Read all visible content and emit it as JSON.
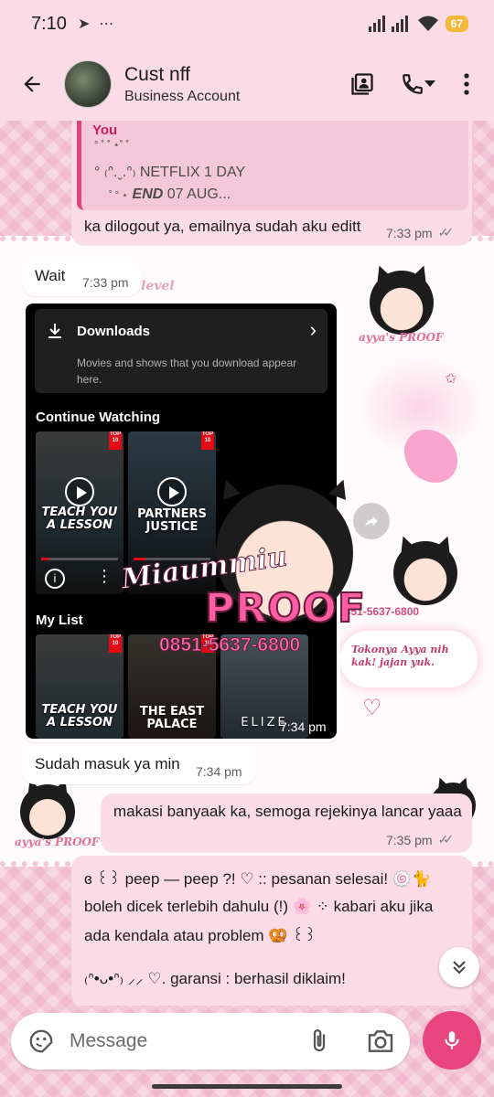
{
  "status_bar": {
    "time": "7:10",
    "battery": "67"
  },
  "header": {
    "contact_name": "Cust nff",
    "subtitle": "Business Account"
  },
  "messages": {
    "quoted": {
      "sender": "You",
      "line1": "°  ˚   ˚ ⋆˚ ˚",
      "line2": "°  ₍ᐢ.ˬ.ᐢ₎ NETFLIX 1 DAY",
      "line3_prefix": "˚ °  ⋆",
      "line3_bold": "END",
      "line3_rest": "07 AUG..."
    },
    "out1": {
      "text": "ka dilogout ya, emailnya sudah aku editt",
      "time": "7:33 pm"
    },
    "in1": {
      "text": "Wait",
      "time": "7:33 pm"
    },
    "image_msg": {
      "time": "7:34 pm",
      "downloads_title": "Downloads",
      "downloads_desc": "Movies and shows that you download appear here.",
      "continue_title": "Continue Watching",
      "mylist_title": "My List",
      "top10_label": "TOP 10",
      "posters": [
        {
          "title": "TEACH YOU A LESSON",
          "progress": 0.1
        },
        {
          "title": "PARTNERS JUSTICE",
          "progress": 0.15
        }
      ],
      "list_posters": [
        "TEACH YOU A LESSON",
        "THE EAST PALACE",
        "ELIZE"
      ]
    },
    "watermark": {
      "script_text": "Miaummiu",
      "proof_text": "PROOF",
      "phone": "0851-5637-6800"
    },
    "in2": {
      "text": "Sudah masuk ya min",
      "time": "7:34 pm"
    },
    "out2": {
      "text": "makasi banyaak ka, semoga rejekinya lancar yaaa",
      "time": "7:35 pm"
    },
    "out3": {
      "line1": "ɞ ꒰꒱ peep — peep  ?!  ♡  :: pesanan selesai!  🍥🐈",
      "line2": "boleh dicek terlebih dahulu  (!)  🌸  ⁘  kabari aku jika",
      "line3": "ada kendala atau problem 🥨  ꒰꒱",
      "line4": "₍ᐢ•ᴗ•ᐢ₎ ⸝⸝  ♡.  garansi : berhasil diklaim!"
    }
  },
  "wallpaper": {
    "sticker_proof": "ayya's PROOF",
    "sticker_phone": "0851-5637-6800",
    "sticker_note": "Tokonya Ayya nih kak! jajan yuk.",
    "sticker_proof2": "ayya's PROOF",
    "sticker_level": "level"
  },
  "input": {
    "placeholder": "Message"
  },
  "colors": {
    "accent": "#e8457f",
    "bubble_out": "#fadbe6",
    "bubble_in": "#ffffff",
    "header_bg": "#fadbe6"
  }
}
